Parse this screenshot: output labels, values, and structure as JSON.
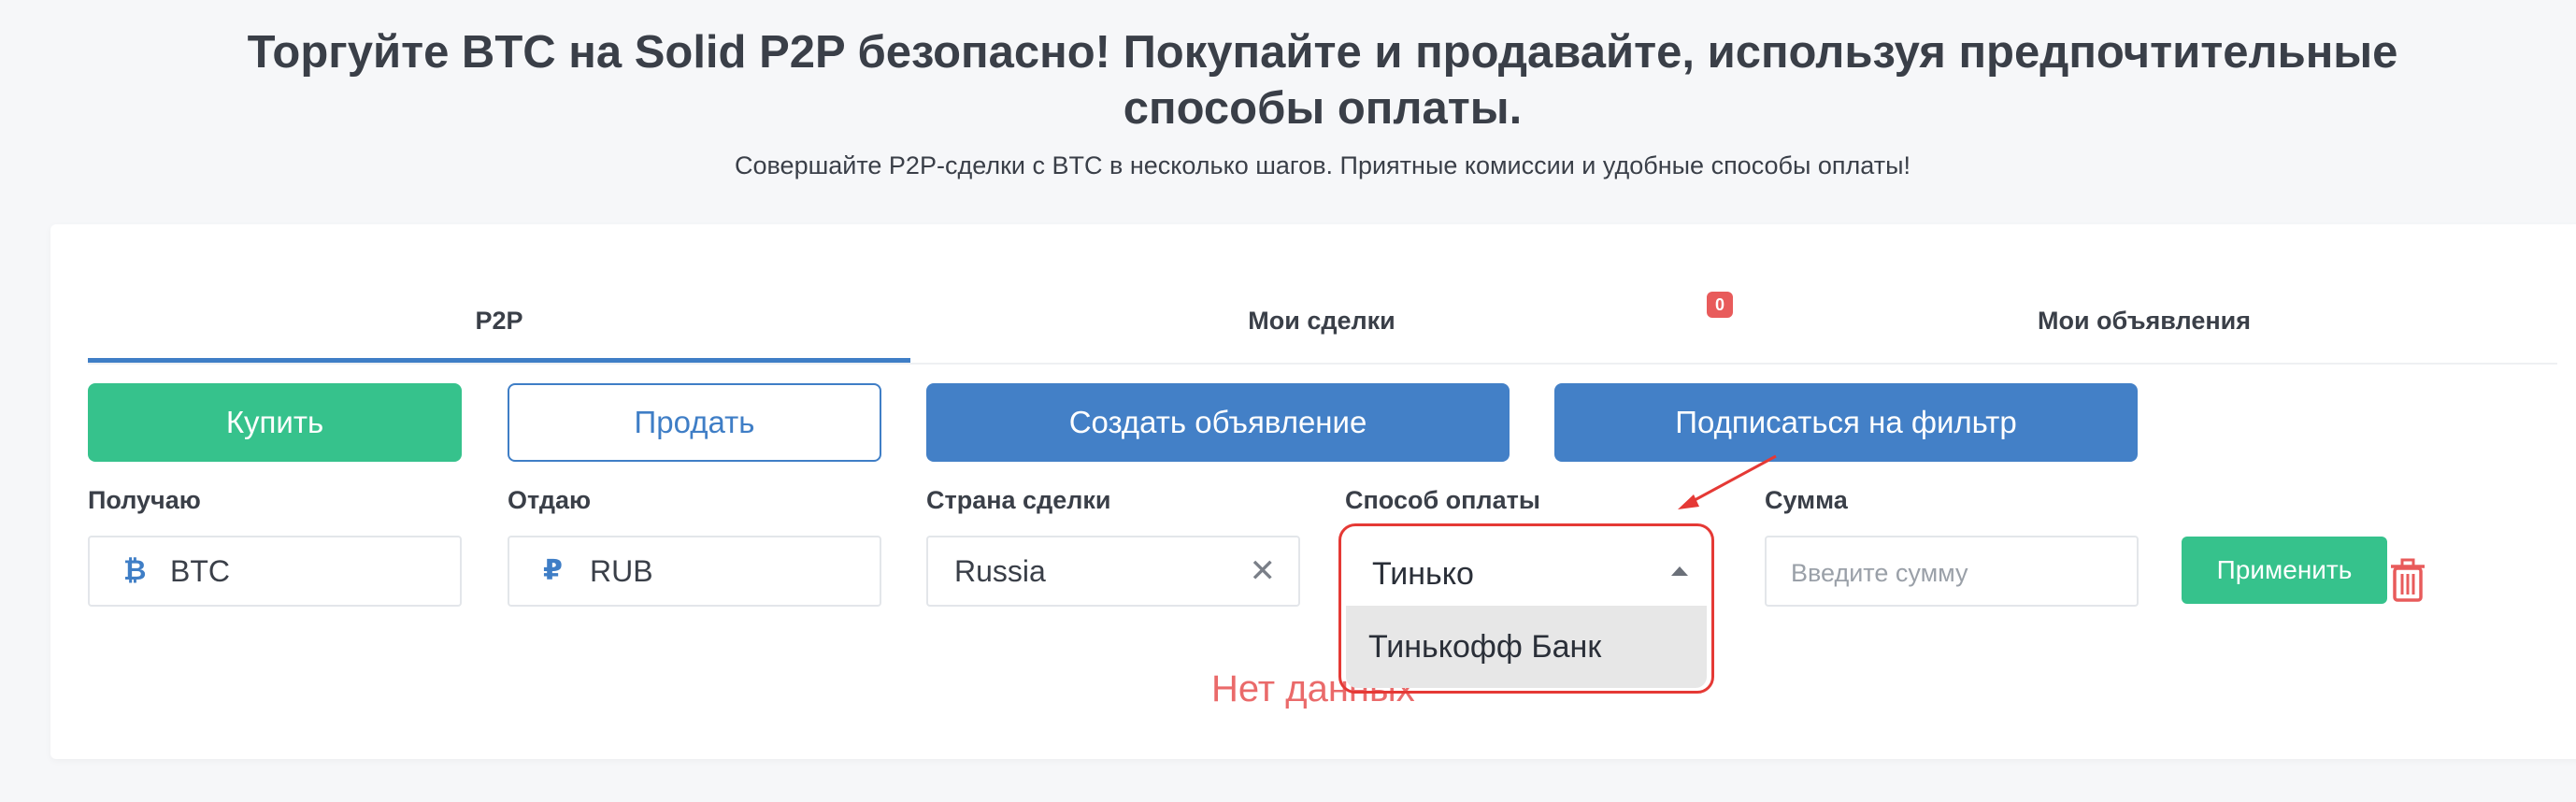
{
  "hero": {
    "title": "Торгуйте BTC на Solid P2P безопасно! Покупайте и продавайте, используя предпочтительные способы оплаты.",
    "subtitle": "Совершайте P2P-сделки с BTC в несколько шагов. Приятные комиссии и удобные способы оплаты!"
  },
  "tabs": [
    {
      "label": "P2P",
      "active": true
    },
    {
      "label": "Мои сделки",
      "active": false
    },
    {
      "label": "Мои объявления",
      "active": false
    }
  ],
  "badge": {
    "count": "0"
  },
  "actions": {
    "buy": "Купить",
    "sell": "Продать",
    "create": "Создать объявление",
    "subscribe": "Подписаться на фильтр"
  },
  "filters": {
    "receive": {
      "label": "Получаю",
      "value": "BTC",
      "icon": "bitcoin-icon",
      "icon_glyph": "₿"
    },
    "give": {
      "label": "Отдаю",
      "value": "RUB",
      "icon": "ruble-icon",
      "icon_glyph": "₽"
    },
    "country": {
      "label": "Страна сделки",
      "value": "Russia",
      "clear_glyph": "✕"
    },
    "payment": {
      "label": "Способ оплаты",
      "value": "Тинько",
      "option": "Тинькофф Банк"
    },
    "amount": {
      "label": "Сумма",
      "placeholder": "Введите сумму"
    },
    "apply": "Применить"
  },
  "empty_state": "Нет данных",
  "colors": {
    "green": "#36c28c",
    "blue": "#4380c7",
    "red_highlight": "#e53935",
    "badge": "#e85b5b"
  }
}
